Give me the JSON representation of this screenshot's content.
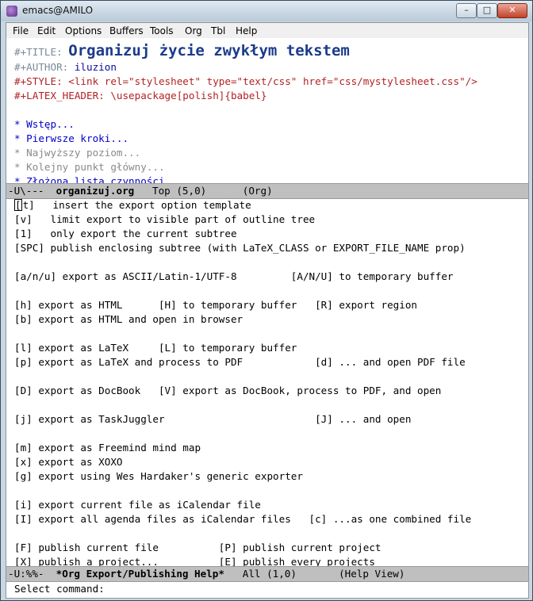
{
  "window": {
    "title": "emacs@AMILO",
    "min_label": "–",
    "max_label": "□",
    "close_label": "✕"
  },
  "menu": [
    "File",
    "Edit",
    "Options",
    "Buffers",
    "Tools",
    "Org",
    "Tbl",
    "Help"
  ],
  "top_buffer": {
    "title_kw": "#+TITLE:",
    "title_val": "Organizuj życie zwykłym tekstem",
    "author_kw": "#+AUTHOR:",
    "author_val": "iluzion",
    "style_line": "#+STYLE: <link rel=\"stylesheet\" type=\"text/css\" href=\"css/mystylesheet.css\"/>",
    "latex_line": "#+LATEX_HEADER: \\usepackage[polish]{babel}",
    "headings": [
      "* Wstęp...",
      "* Pierwsze kroki...",
      "* Najwyższy poziom...",
      "* Kolejny punkt główny...",
      "* Złożona lista czynności"
    ]
  },
  "modeline1": {
    "state": "-U\\---",
    "buffer": "organizuj.org",
    "pos": "Top (5,0)",
    "mode": "(Org)"
  },
  "help_lines": [
    "[t]   insert the export option template",
    "[v]   limit export to visible part of outline tree",
    "[1]   only export the current subtree",
    "[SPC] publish enclosing subtree (with LaTeX_CLASS or EXPORT_FILE_NAME prop)",
    "",
    "[a/n/u] export as ASCII/Latin-1/UTF-8         [A/N/U] to temporary buffer",
    "",
    "[h] export as HTML      [H] to temporary buffer   [R] export region",
    "[b] export as HTML and open in browser",
    "",
    "[l] export as LaTeX     [L] to temporary buffer",
    "[p] export as LaTeX and process to PDF            [d] ... and open PDF file",
    "",
    "[D] export as DocBook   [V] export as DocBook, process to PDF, and open",
    "",
    "[j] export as TaskJuggler                         [J] ... and open",
    "",
    "[m] export as Freemind mind map",
    "[x] export as XOXO",
    "[g] export using Wes Hardaker's generic exporter",
    "",
    "[i] export current file as iCalendar file",
    "[I] export all agenda files as iCalendar files   [c] ...as one combined file",
    "",
    "[F] publish current file          [P] publish current project",
    "[X] publish a project...          [E] publish every projects"
  ],
  "modeline2": {
    "state": "-U:%%-",
    "buffer": "*Org Export/Publishing Help*",
    "pos": "All (1,0)",
    "mode": "(Help View)"
  },
  "minibuffer": "Select command:"
}
